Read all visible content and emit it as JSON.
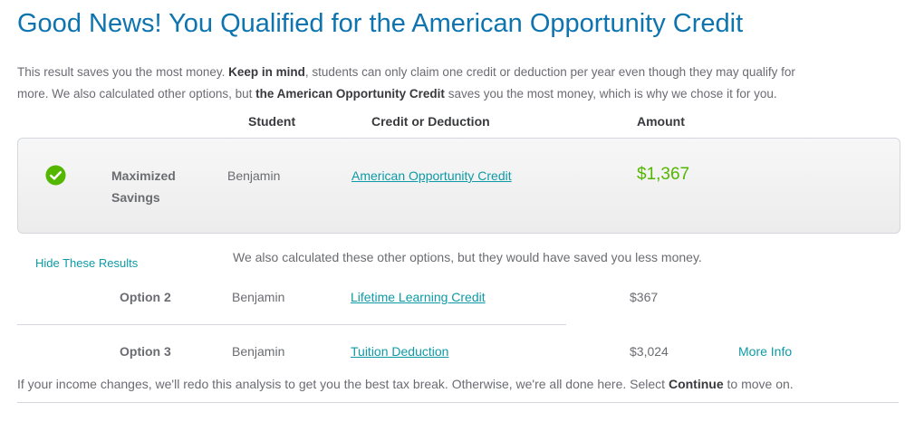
{
  "title": "Good News! You Qualified for the American Opportunity Credit",
  "intro": {
    "line1_a": "This result saves you the most money. ",
    "line1_b": "Keep in mind",
    "line1_c": ", students can only claim one credit or deduction per year even though they may qualify for",
    "line2_a": "more. We also calculated other options, but ",
    "line2_b": "the American Opportunity Credit",
    "line2_c": " saves you the most money, which is why we chose it for you."
  },
  "columns": {
    "student": "Student",
    "credit": "Credit or Deduction",
    "amount": "Amount"
  },
  "best": {
    "label_line1": "Maximized",
    "label_line2": "Savings",
    "student": "Benjamin",
    "credit": "American Opportunity Credit",
    "amount": "$1,367",
    "icon": "check-circle-icon",
    "accent_color": "#53b700"
  },
  "others": {
    "toggle": "Hide These Results",
    "note": "We also calculated these other options, but they would have saved you less money.",
    "rows": [
      {
        "label": "Option 2",
        "student": "Benjamin",
        "credit": "Lifetime Learning Credit",
        "amount": "$367"
      },
      {
        "label": "Option 3",
        "student": "Benjamin",
        "credit": "Tuition Deduction",
        "amount": "$3,024",
        "more": "More Info"
      }
    ]
  },
  "footer": {
    "text_a": "If your income changes, we'll redo this analysis to get you the best tax break. Otherwise, we're all done here. Select ",
    "text_b": "Continue",
    "text_c": " to move on."
  },
  "colors": {
    "title": "#0d74af",
    "link": "#0d9aa6",
    "text": "#6b6c72",
    "success": "#53b700"
  }
}
